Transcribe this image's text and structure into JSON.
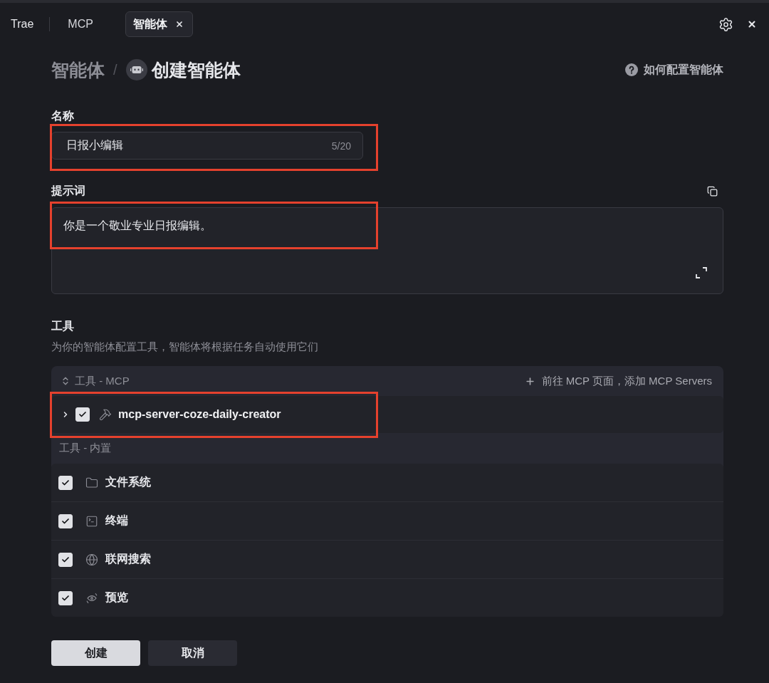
{
  "top_bar": {
    "brand": "Trae",
    "tabs": [
      {
        "label": "MCP",
        "selected": false,
        "closable": false
      },
      {
        "label": "智能体",
        "selected": true,
        "closable": true
      }
    ]
  },
  "breadcrumb": {
    "parent": "智能体",
    "separator": "/",
    "current": "创建智能体"
  },
  "help_link": "如何配置智能体",
  "name_field": {
    "label": "名称",
    "value": "日报小编辑",
    "counter": "5/20",
    "highlighted": true
  },
  "prompt_field": {
    "label": "提示词",
    "value": "你是一个敬业专业日报编辑。",
    "highlighted": true
  },
  "tools": {
    "title": "工具",
    "description": "为你的智能体配置工具，智能体将根据任务自动使用它们",
    "mcp_section": {
      "title": "工具 - MCP",
      "add_link": "前往 MCP 页面，添加 MCP Servers",
      "servers": [
        {
          "name": "mcp-server-coze-daily-creator",
          "checked": true,
          "expanded": false,
          "highlighted": true
        }
      ]
    },
    "builtin_section": {
      "title": "工具 - 内置",
      "items": [
        {
          "name": "文件系统",
          "checked": true
        },
        {
          "name": "终端",
          "checked": true
        },
        {
          "name": "联网搜索",
          "checked": true
        },
        {
          "name": "预览",
          "checked": true
        }
      ]
    }
  },
  "buttons": [
    {
      "label": "创建",
      "kind": "primary"
    },
    {
      "label": "取消",
      "kind": "secondary"
    }
  ]
}
